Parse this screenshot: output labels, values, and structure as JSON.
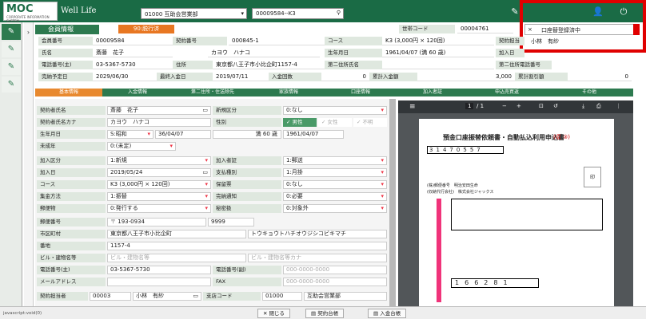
{
  "topbar": {
    "logo_main": "MOC",
    "logo_sub": "CORPORATE INFORMATION SYSTEM",
    "app_name": "Well Life",
    "branch_select": "01000 互助会営業部",
    "member_search": "00009584--K3",
    "edit_icon": "pencil-icon",
    "user_icon": "user-icon",
    "power_icon": "power-icon"
  },
  "notice": {
    "label": "口座替登録済中",
    "close": "×",
    "person": "小林　有紗"
  },
  "header": {
    "title": "会員情報",
    "status_badge": "90:脱行済"
  },
  "summary": {
    "member_no_label": "会員番号",
    "member_no": "00009584",
    "contract_no_label": "契約番号",
    "contract_no": "000845-1",
    "course_label": "コース",
    "course": "K3 (3,000円 × 120回)",
    "family_code_label": "世帯コード",
    "family_code": "00004761",
    "contract_person_label": "契約担当",
    "name_label": "氏名",
    "name": "斎藤　花子",
    "kana": "カヨウ　ハナコ",
    "birth_label": "生年月日",
    "birth": "1961/04/07 (満 60 歳)",
    "join_label": "加入日",
    "phone_label": "電話番号(主)",
    "phone": "03-5367-5730",
    "address_label": "住所",
    "address": "東京都八王子市小比企町1157-4",
    "addr2_label": "第二住所氏名",
    "addr2_phone_label": "第二住所電話番号",
    "complete_label": "完納予定日",
    "complete": "2029/06/30",
    "last_pay_label": "最終入金日",
    "last_pay": "2019/07/11",
    "pay_count_label": "入金回数",
    "pay_count": "0",
    "total_label": "累計入金額",
    "total": "3,000",
    "discount_label": "累計割引額",
    "discount": "0"
  },
  "tabs": [
    "基本情報",
    "入金情報",
    "第二住所・住送除先",
    "家族情報",
    "口座情報",
    "加入者証",
    "申込売買返",
    "その他"
  ],
  "form": {
    "contractor_name_label": "契約者氏名",
    "contractor_name": "斎藤　花子",
    "new_type_label": "新規区分",
    "new_type": "0:なし",
    "contractor_kana_label": "契約者氏名カナ",
    "contractor_kana": "カヨウ　ハナコ",
    "gender_label": "性別",
    "gender_male": "男性",
    "gender_female": "女性",
    "gender_unknown": "不明",
    "birth_label": "生年月日",
    "birth_era": "S:昭和",
    "birth_wareki": "36/04/07",
    "age": "満 60 歳",
    "birth_date": "1961/04/07",
    "minor_label": "未成年",
    "minor": "0:(未定)",
    "join_type_label": "加入区分",
    "join_type": "1:新規",
    "cert_label": "加入者証",
    "cert": "1:郵送",
    "join_date_label": "加入日",
    "join_date": "2019/05/24",
    "pay_type_label": "支払種別",
    "pay_type": "1:月掛",
    "course_label": "コース",
    "course": "K3 (3,000円 × 120回)",
    "insurance_label": "保留票",
    "insurance": "0:なし",
    "collect_label": "集金方法",
    "collect": "1:振替",
    "notice_label": "完納通知",
    "notice": "0:必要",
    "mail_label": "郵便物",
    "mail": "0:発行する",
    "secret_label": "秘密扱",
    "secret": "0:対象外",
    "zip_label": "郵便番号",
    "zip": "193-0934",
    "zip_sub": "9999",
    "city_label": "市区町村",
    "city": "東京都八王子市小比企町",
    "city_kana": "トウキョウトハチオウジシコビキマチ",
    "street_label": "番地",
    "street": "1157-4",
    "bldg_label": "ビル・建物名等",
    "bldg_placeholder": "ビル・建物名等",
    "bldg_kana_placeholder": "ビル・建物名等カナ",
    "phone_label": "電話番号(主)",
    "phone": "03-5367-5730",
    "phone2_label": "電話番号(副)",
    "phone2_placeholder": "000-0000-0000",
    "email_label": "メールアドレス",
    "fax_label": "FAX",
    "fax_placeholder": "000-0000-0000",
    "staff_label": "契約担当者",
    "staff_code": "00003",
    "staff_name": "小林　有紗",
    "branch_label": "支店コード",
    "branch_code": "01000",
    "branch_name": "互助会営業部"
  },
  "pdf": {
    "page_current": "1",
    "page_total": "/ 1",
    "doc_title": "預金口座振替依頼書・自動払込利用申込書",
    "doc_title_tag": "(収 ③)",
    "num1": "3",
    "num2": "1",
    "num3": "4",
    "num4": "7",
    "num5": "0",
    "num6": "5",
    "num7": "5",
    "num8": "7",
    "acct1": "1",
    "acct2": "6",
    "acct3": "6",
    "acct4": "2",
    "acct5": "8",
    "acct6": "1",
    "company_line": "(株)郵便番号　明治安田生命",
    "company_name": "(収納代行会社)　株式会社ジャックス",
    "stamp_box": "印"
  },
  "footer": {
    "status": "javascript:void(0)",
    "close_btn": "閉じる",
    "contract_btn": "契約台帳",
    "payment_btn": "入金台帳"
  }
}
